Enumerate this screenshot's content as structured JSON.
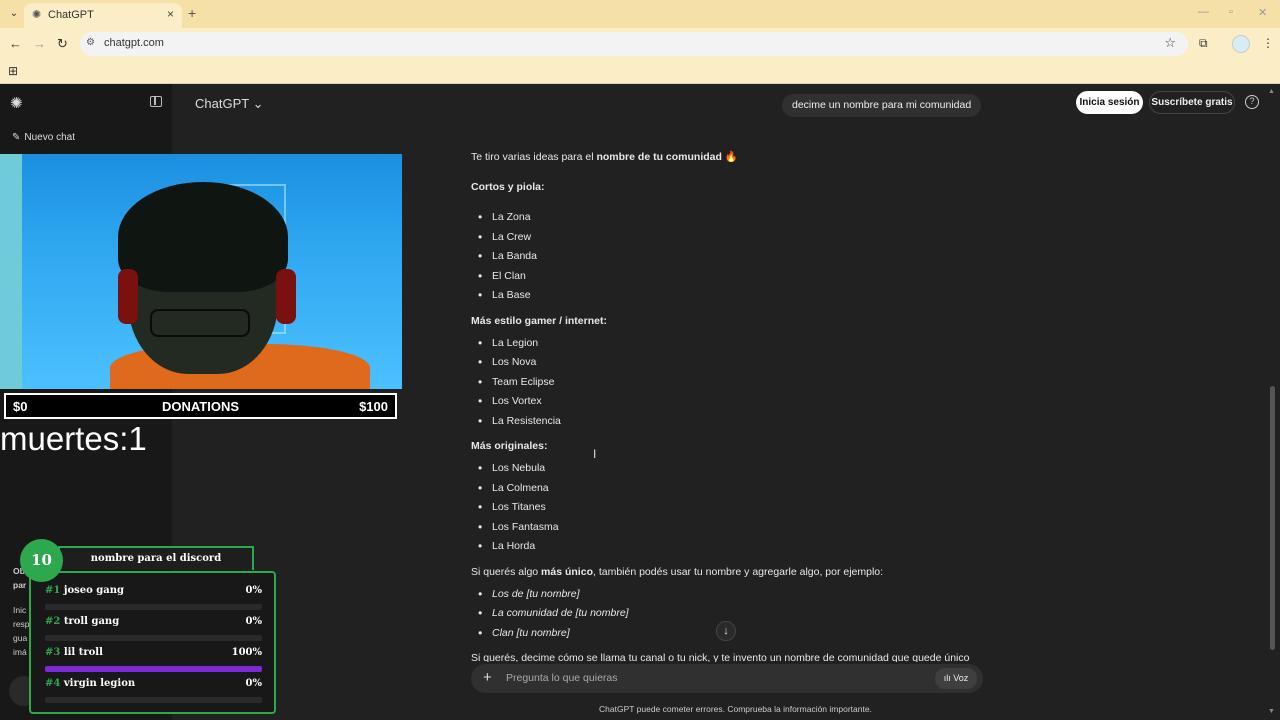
{
  "browser": {
    "tab_title": "ChatGPT",
    "url": "chatgpt.com"
  },
  "sidebar": {
    "new_chat": "Nuevo chat",
    "leftover_lines": [
      "Ob",
      "par",
      "Inic",
      "resp",
      "gua",
      "imá"
    ]
  },
  "header": {
    "model": "ChatGPT",
    "login": "Inicia sesión",
    "signup": "Suscríbete gratis"
  },
  "user_message": "decime un nombre para mi comunidad",
  "response": {
    "intro_a": "Te tiro varias ideas para el ",
    "intro_b": "nombre de tu comunidad",
    "intro_emoji": "🔥",
    "sections": [
      {
        "title": "Cortos y piola:",
        "items": [
          "La Zona",
          "La Crew",
          "La Banda",
          "El Clan",
          "La Base"
        ]
      },
      {
        "title": "Más estilo gamer / internet:",
        "items": [
          "La Legion",
          "Los Nova",
          "Team Eclipse",
          "Los Vortex",
          "La Resistencia"
        ]
      },
      {
        "title": "Más originales:",
        "items": [
          "Los Nebula",
          "La Colmena",
          "Los Titanes",
          "Los Fantasma",
          "La Horda"
        ]
      }
    ],
    "extra_a": "Si querés algo ",
    "extra_b": "más único",
    "extra_c": ", también podés usar tu nombre y agregarle algo, por ejemplo:",
    "examples": [
      "Los de [tu nombre]",
      "La comunidad de [tu nombre]",
      "Clan [tu nombre]"
    ],
    "cut_line": "Si querés, decime cómo se llama tu canal o tu nick, y te invento un nombre de comunidad que quede único"
  },
  "composer": {
    "placeholder": "Pregunta lo que quieras",
    "voice": "Voz"
  },
  "disclaimer": "ChatGPT puede cometer errores. Comprueba la información importante.",
  "stream": {
    "donations": {
      "min": "$0",
      "label": "DONATIONS",
      "max": "$100"
    },
    "muertes": "muertes:1",
    "poll": {
      "timer": "10",
      "title": "nombre para el discord",
      "options": [
        {
          "num": "#1",
          "name": "joseo gang",
          "pct": "0%",
          "value": 0
        },
        {
          "num": "#2",
          "name": "troll gang",
          "pct": "0%",
          "value": 0
        },
        {
          "num": "#3",
          "name": "lil troll",
          "pct": "100%",
          "value": 100
        },
        {
          "num": "#4",
          "name": "virgin legion",
          "pct": "0%",
          "value": 0
        }
      ]
    }
  },
  "colors": {
    "poll_accent": "#2ea84f",
    "poll_bar": "#7d2ad6",
    "page_bg": "#212121"
  }
}
